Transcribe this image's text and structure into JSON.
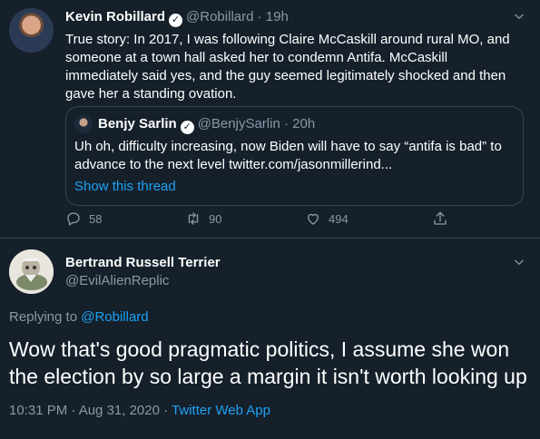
{
  "tweet": {
    "author_name": "Kevin Robillard",
    "verified_mark": "✓",
    "handle": "@Robillard",
    "separator": "·",
    "time": "19h",
    "text": "True story: In 2017, I was following Claire McCaskill around rural MO, and someone at a town hall asked her to condemn Antifa. McCaskill immediately said yes, and the guy seemed legitimately shocked and then gave her a standing ovation.",
    "quote": {
      "author_name": "Benjy Sarlin",
      "handle": "@BenjySarlin",
      "time": "20h",
      "text": "Uh oh, difficulty increasing, now Biden will have to say “antifa is bad” to advance to the next level twitter.com/jasonmillerind...",
      "show_thread": "Show this thread"
    },
    "actions": {
      "replies": "58",
      "retweets": "90",
      "likes": "494"
    }
  },
  "reply": {
    "author_name": "Bertrand Russell Terrier",
    "handle": "@EvilAlienReplic",
    "replying_prefix": "Replying to ",
    "replying_to": "@Robillard",
    "text": "Wow that's good pragmatic politics, I assume she won the election by so large a margin it isn't worth looking up",
    "timestamp": "10:31 PM · Aug 31, 2020",
    "source": "Twitter Web App"
  },
  "icons": [
    "chevron-down-icon",
    "verified-icon",
    "reply-icon",
    "retweet-icon",
    "like-icon",
    "share-icon"
  ],
  "colors": {
    "background": "#15202b",
    "text": "#ffffff",
    "muted": "#8899a6",
    "link": "#1da1f2",
    "border": "#38444d"
  }
}
